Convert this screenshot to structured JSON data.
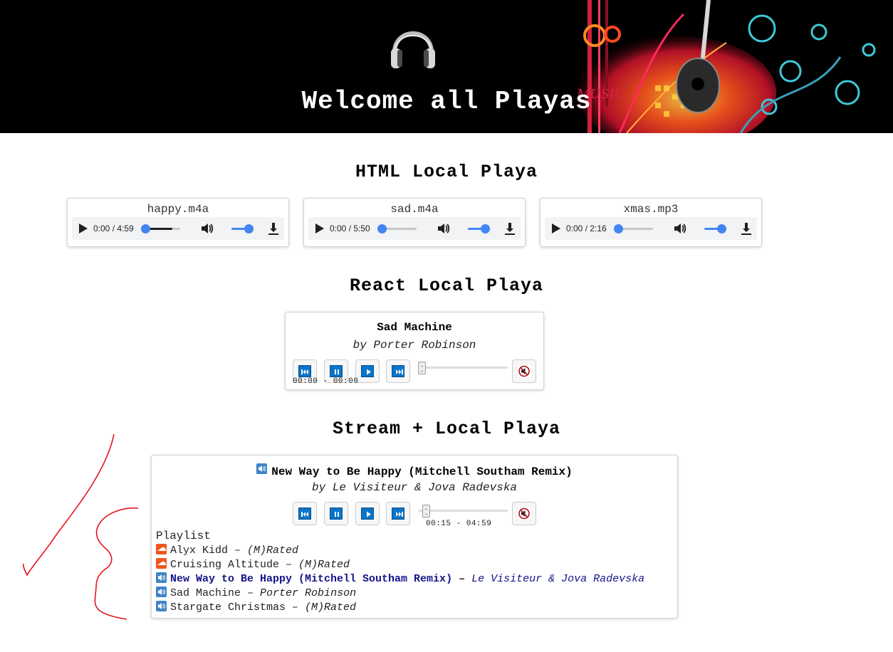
{
  "banner": {
    "title": "Welcome all Playas",
    "art_word": "MUSIC"
  },
  "sections": {
    "html_title": "HTML Local Playa",
    "react_title": "React Local Playa",
    "stream_title": "Stream + Local Playa"
  },
  "html_players": [
    {
      "file": "happy.m4a",
      "time": "0:00 / 4:59",
      "progress": 0.0,
      "buffered": 0.78
    },
    {
      "file": "sad.m4a",
      "time": "0:00 / 5:50",
      "progress": 0.0,
      "buffered": 0.1
    },
    {
      "file": "xmas.mp3",
      "time": "0:00 / 2:16",
      "progress": 0.0,
      "buffered": 0.0
    }
  ],
  "react_player": {
    "title": "Sad Machine",
    "artist": "by Porter Robinson",
    "time": "00:00 - 00:00",
    "progress": 0.0
  },
  "stream_player": {
    "title": "New Way to Be Happy (Mitchell Southam Remix)",
    "artist": "by Le Visiteur & Jova Radevska",
    "time": "00:15 - 04:59",
    "progress": 0.05,
    "playlist_label": "Playlist",
    "playlist": [
      {
        "title": "Alyx Kidd",
        "sep": " – ",
        "artist": "(M)Rated",
        "source": "soundcloud",
        "active": false
      },
      {
        "title": "Cruising Altitude",
        "sep": " – ",
        "artist": "(M)Rated",
        "source": "soundcloud",
        "active": false
      },
      {
        "title": "New Way to Be Happy (Mitchell Southam Remix)",
        "sep": " – ",
        "artist": "Le Visiteur & Jova Radevska",
        "source": "local",
        "active": true
      },
      {
        "title": "Sad Machine",
        "sep": " – ",
        "artist": "Porter Robinson",
        "source": "local",
        "active": false
      },
      {
        "title": "Stargate Christmas",
        "sep": " – ",
        "artist": "(M)Rated",
        "source": "local",
        "active": false
      }
    ]
  },
  "icons": {
    "headphones": "headphones-icon",
    "play": "play-icon",
    "volume": "volume-icon",
    "download": "download-icon",
    "prev": "skip-back-icon",
    "pause": "pause-icon",
    "next": "skip-forward-icon",
    "mute": "mute-icon",
    "soundcloud": "soundcloud-icon",
    "speaker": "speaker-icon"
  },
  "colors": {
    "banner_bg": "#000000",
    "accent_blue": "#4285f4",
    "control_blue": "#0a74c8",
    "active_track": "#14148a",
    "soundcloud": "#f2551b",
    "annotation_red": "#e8141b"
  }
}
